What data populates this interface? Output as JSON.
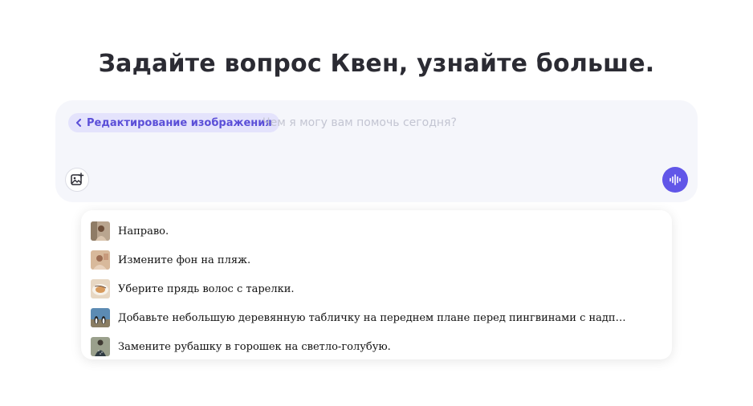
{
  "heading": "Задайте вопрос Квен, узнайте больше.",
  "composer": {
    "mode_chip_label": "Редактирование изображения",
    "placeholder": "Чем я могу вам помочь сегодня?",
    "upload_icon": "image-upload-icon",
    "voice_icon": "voice-waveform-icon"
  },
  "colors": {
    "accent": "#6156e8",
    "chip_bg": "#e4e3fc",
    "chip_text": "#5b4fd8",
    "composer_bg": "#f5f6fb"
  },
  "suggestions": [
    {
      "text": "Направо.",
      "thumb": "portrait-thumbnail"
    },
    {
      "text": "Измените фон на пляж.",
      "thumb": "portrait-thumbnail"
    },
    {
      "text": "Уберите прядь волос с тарелки.",
      "thumb": "food-plate-thumbnail"
    },
    {
      "text": "Добавьте небольшую деревянную табличку на переднем плане перед пингвинами с надписью «Добро…",
      "thumb": "penguins-thumbnail"
    },
    {
      "text": "Замените рубашку в горошек на светло-голубую.",
      "thumb": "person-thumbnail"
    }
  ]
}
